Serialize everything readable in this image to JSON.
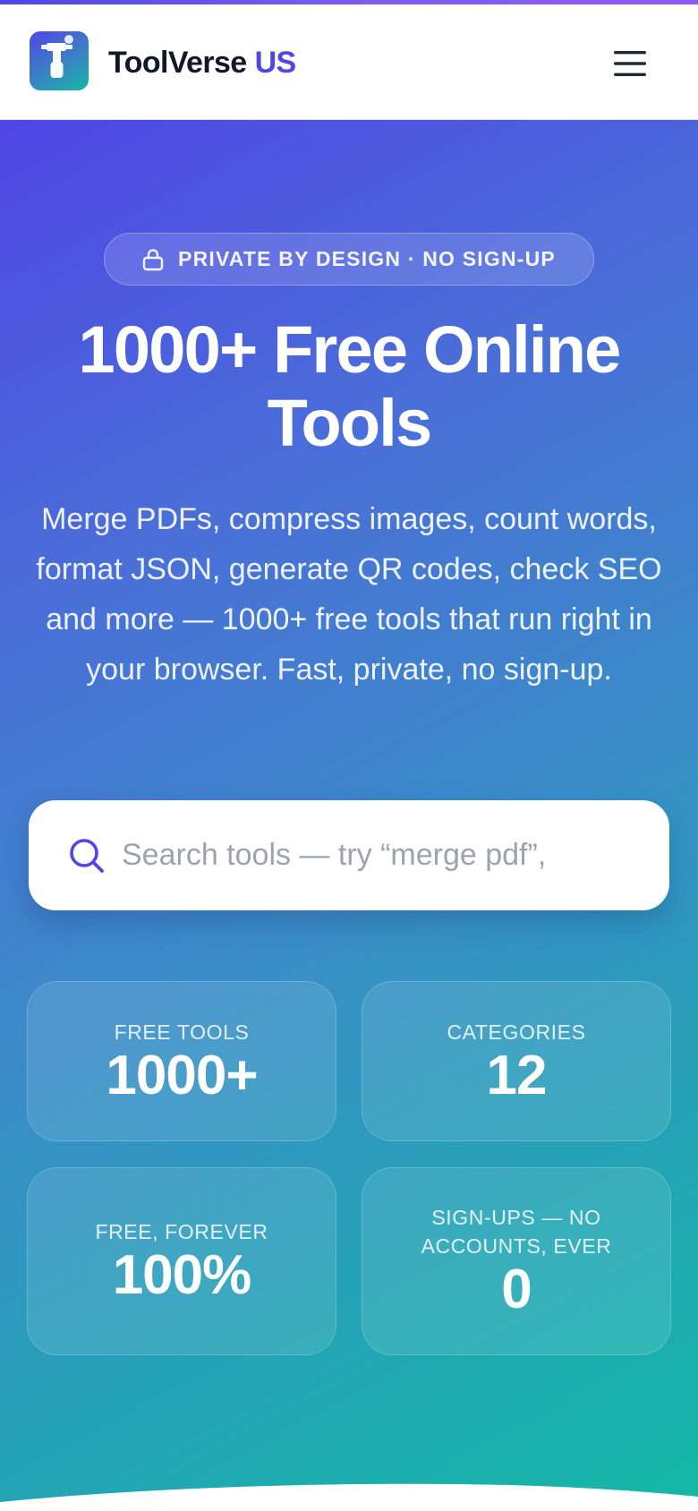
{
  "brand": {
    "name": "ToolVerse",
    "suffix": "US",
    "icon": "paint-roller-t-logo"
  },
  "header": {
    "menu_icon": "hamburger-menu-icon"
  },
  "hero": {
    "badge_icon": "lock-icon",
    "badge": "PRIVATE BY DESIGN · NO SIGN-UP",
    "title": "1000+ Free Online Tools",
    "description": "Merge PDFs, compress images, count words, format JSON, generate QR codes, check SEO and more — 1000+ free tools that run right in your browser. Fast, private, no sign-up."
  },
  "search": {
    "icon": "search-icon",
    "value": "",
    "placeholder": "Search tools — try “merge pdf”,"
  },
  "stats": [
    {
      "label": "FREE TOOLS",
      "value": "1000+"
    },
    {
      "label": "CATEGORIES",
      "value": "12"
    },
    {
      "label": "FREE, FOREVER",
      "value": "100%"
    },
    {
      "label": "SIGN-UPS — NO ACCOUNTS, EVER",
      "value": "0"
    }
  ],
  "colors": {
    "accent": "#4f46e5",
    "gradient_start": "#4f46e5",
    "gradient_end": "#14b8a6",
    "text_dark": "#111827"
  }
}
